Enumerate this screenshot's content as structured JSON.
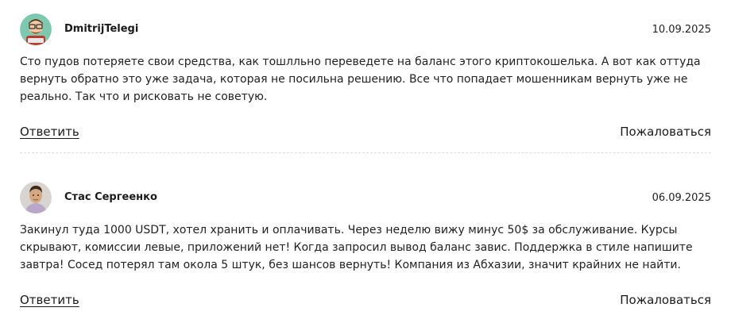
{
  "comments": [
    {
      "author": "DmitrijTelegi",
      "date": "10.09.2025",
      "text": "Сто пудов потеряете свои средства, как тошлльно переведете на баланс этого криптокошелька. А вот как оттуда вернуть обратно это уже задача, которая не посильна решению. Все что попадает мошенникам вернуть уже не реально. Так что и рисковать не советую.",
      "reply_label": "Ответить",
      "report_label": "Пожаловаться",
      "avatar_icon": "cartoon-avatar-icon"
    },
    {
      "author": "Стас Сергеенко",
      "date": "06.09.2025",
      "text": "Закинул туда 1000 USDT, хотел хранить и оплачивать. Через неделю вижу минус 50$ за обслуживание. Курсы скрывают, комиссии левые, приложений нет! Когда запросил вывод баланс завис. Поддержка в стиле напишите завтра! Сосед потерял там окола 5 штук, без шансов вернуть! Компания из Абхазии, значит крайних не найти.",
      "reply_label": "Ответить",
      "report_label": "Пожаловаться",
      "avatar_icon": "photo-avatar-icon"
    }
  ]
}
